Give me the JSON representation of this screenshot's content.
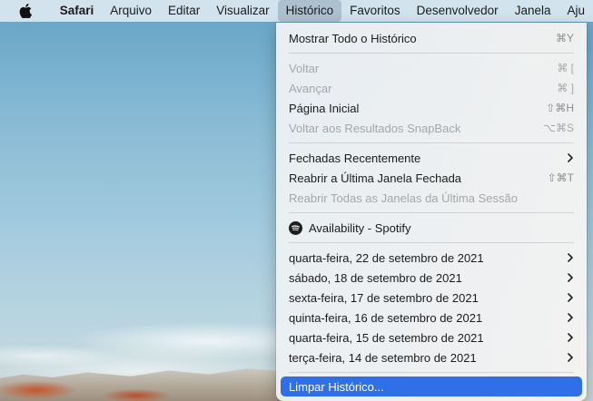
{
  "menubar": {
    "app": "Safari",
    "items": [
      "Arquivo",
      "Editar",
      "Visualizar",
      "Histórico",
      "Favoritos",
      "Desenvolvedor",
      "Janela",
      "Aju"
    ]
  },
  "menu": {
    "show_all": {
      "label": "Mostrar Todo o Histórico",
      "shortcut": "⌘Y"
    },
    "back": {
      "label": "Voltar",
      "shortcut": "⌘ ["
    },
    "forward": {
      "label": "Avançar",
      "shortcut": "⌘ ]"
    },
    "home": {
      "label": "Página Inicial",
      "shortcut": "⇧⌘H"
    },
    "snapback": {
      "label": "Voltar aos Resultados SnapBack",
      "shortcut": "⌥⌘S"
    },
    "recently_closed": {
      "label": "Fechadas Recentemente"
    },
    "reopen_last": {
      "label": "Reabrir a Última Janela Fechada",
      "shortcut": "⇧⌘T"
    },
    "reopen_all": {
      "label": "Reabrir Todas as Janelas da Última Sessão"
    },
    "spotify": {
      "label": "Availability - Spotify"
    },
    "days": [
      "quarta-feira, 22 de setembro de 2021",
      "sábado, 18 de setembro de 2021",
      "sexta-feira, 17 de setembro de 2021",
      "quinta-feira, 16 de setembro de 2021",
      "quarta-feira, 15 de setembro de 2021",
      "terça-feira, 14 de setembro de 2021"
    ],
    "clear": {
      "label": "Limpar Histórico..."
    }
  },
  "colors": {
    "highlight": "#2f6fe8",
    "disabled_text": "#a6a6a6"
  }
}
